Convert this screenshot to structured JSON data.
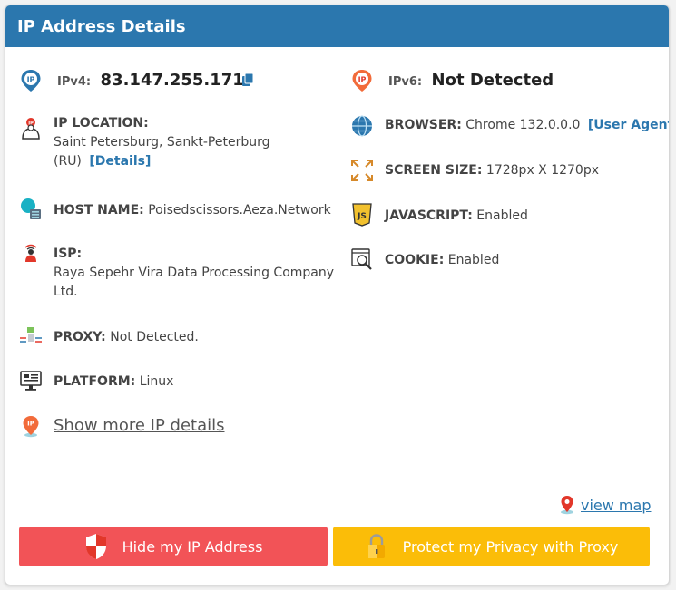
{
  "header": {
    "title": "IP Address Details"
  },
  "ipv4": {
    "label": "IPv4:",
    "value": "83.147.255.171",
    "icon": "ip-pin-icon"
  },
  "ipv6": {
    "label": "IPv6:",
    "value": "Not Detected",
    "icon": "ip-pin-orange-icon"
  },
  "left": {
    "location": {
      "label": "IP LOCATION:",
      "line1": "Saint Petersburg, Sankt-Peterburg",
      "line2": "(RU)",
      "details_link": "[Details]"
    },
    "host": {
      "label": "HOST NAME:",
      "value": "Poisedscissors.Aeza.Network"
    },
    "isp": {
      "label": "ISP:",
      "line1": "Raya Sepehr Vira Data Processing Company",
      "line2": "Ltd."
    },
    "proxy": {
      "label": "PROXY:",
      "value": "Not Detected."
    },
    "platform": {
      "label": "PLATFORM:",
      "value": "Linux"
    },
    "more": {
      "label": "Show more IP details"
    }
  },
  "right": {
    "browser": {
      "label": "BROWSER:",
      "value": "Chrome 132.0.0.0",
      "ua_link": "[User Agent]"
    },
    "screen": {
      "label": "SCREEN SIZE:",
      "value": "1728px X 1270px"
    },
    "javascript": {
      "label": "JAVASCRIPT:",
      "value": "Enabled"
    },
    "cookie": {
      "label": "COOKIE:",
      "value": "Enabled"
    }
  },
  "map": {
    "label": "view map"
  },
  "buttons": {
    "hide_ip": {
      "label": "Hide my IP Address",
      "color": "#f25357"
    },
    "protect": {
      "label": "Protect my Privacy with Proxy",
      "color": "#fbbd08"
    }
  },
  "colors": {
    "header": "#2b77ae",
    "link": "#2b77ae"
  }
}
